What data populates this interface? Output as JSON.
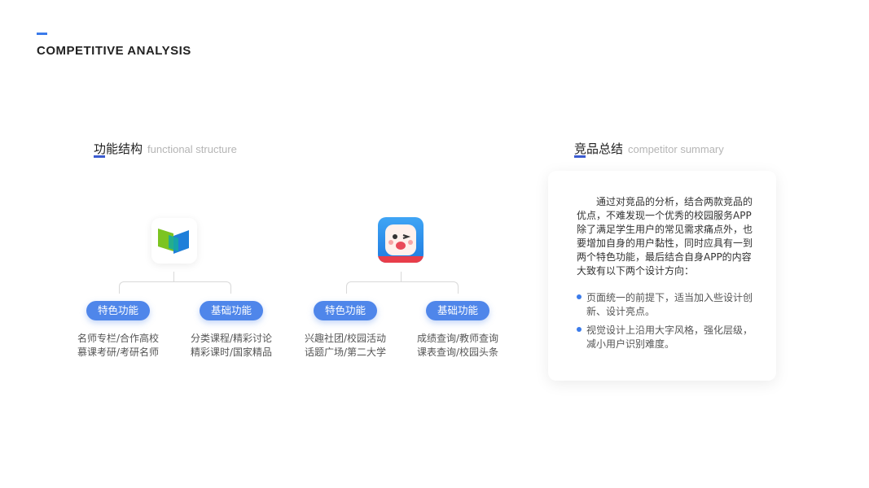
{
  "header": {
    "title": "COMPETITIVE ANALYSIS"
  },
  "left_section": {
    "title_zh": "功能结构",
    "title_en": "functional structure"
  },
  "right_section": {
    "title_zh": "竞品总结",
    "title_en": "competitor summary"
  },
  "apps": [
    {
      "logo_icon": "green-blue-book-logo-icon",
      "branches": [
        {
          "label": "特色功能",
          "lines": [
            "名师专栏/合作高校",
            "慕课考研/考研名师"
          ]
        },
        {
          "label": "基础功能",
          "lines": [
            "分类课程/精彩讨论",
            "精彩课时/国家精品"
          ]
        }
      ]
    },
    {
      "logo_icon": "cartoon-mascot-logo-icon",
      "branches": [
        {
          "label": "特色功能",
          "lines": [
            "兴趣社团/校园活动",
            "话题广场/第二大学"
          ]
        },
        {
          "label": "基础功能",
          "lines": [
            "成绩查询/教师查询",
            "课表查询/校园头条"
          ]
        }
      ]
    }
  ],
  "summary": {
    "paragraph": "通过对竞品的分析，结合两款竞品的优点，不难发现一个优秀的校园服务APP除了满足学生用户的常见需求痛点外，也要增加自身的用户黏性，同时应具有一到两个特色功能，最后结合自身APP的内容大致有以下两个设计方向：",
    "bullets": [
      "页面统一的前提下，适当加入些设计创新、设计亮点。",
      "视觉设计上沿用大字风格，强化层级，减小用户识别难度。"
    ]
  },
  "colors": {
    "accent": "#3b7bea",
    "pill": "#4f86ea"
  }
}
